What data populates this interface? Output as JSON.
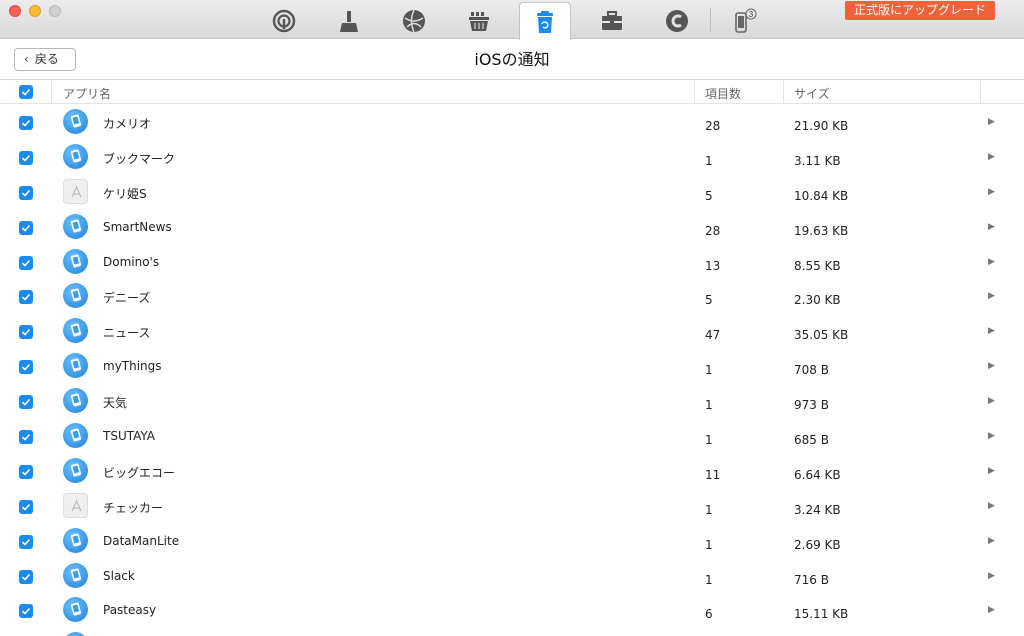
{
  "window": {
    "traffic_lights": [
      "close",
      "minimize",
      "zoom"
    ]
  },
  "toolbar": {
    "icons": [
      "airbackup-icon",
      "cleaner-icon",
      "internet-icon",
      "basket-icon",
      "trash-icon",
      "toolbox-icon",
      "copyright-icon",
      "device-icon"
    ],
    "active_icon": "trash-icon",
    "device_badge": "3",
    "upgrade_label": "正式版にアップグレード",
    "accent": "#f0623a"
  },
  "header": {
    "back_label": "戻る",
    "title": "iOSの通知"
  },
  "table": {
    "columns": {
      "name": "アプリ名",
      "count": "項目数",
      "size": "サイズ"
    },
    "check_color": "#1a8cf0",
    "rows": [
      {
        "name": "カメリオ",
        "count": "28",
        "size": "21.90 KB",
        "icon": "blue"
      },
      {
        "name": "ブックマーク",
        "count": "1",
        "size": "3.11 KB",
        "icon": "blue"
      },
      {
        "name": "ケリ姫S",
        "count": "5",
        "size": "10.84 KB",
        "icon": "store"
      },
      {
        "name": "SmartNews",
        "count": "28",
        "size": "19.63 KB",
        "icon": "blue"
      },
      {
        "name": "Domino's",
        "count": "13",
        "size": "8.55 KB",
        "icon": "blue"
      },
      {
        "name": "デニーズ",
        "count": "5",
        "size": "2.30 KB",
        "icon": "blue"
      },
      {
        "name": "ニュース",
        "count": "47",
        "size": "35.05 KB",
        "icon": "blue"
      },
      {
        "name": "myThings",
        "count": "1",
        "size": "708 B",
        "icon": "blue"
      },
      {
        "name": "天気",
        "count": "1",
        "size": "973 B",
        "icon": "blue"
      },
      {
        "name": "TSUTAYA",
        "count": "1",
        "size": "685 B",
        "icon": "blue"
      },
      {
        "name": "ビッグエコー",
        "count": "11",
        "size": "6.64 KB",
        "icon": "blue"
      },
      {
        "name": "チェッカー",
        "count": "1",
        "size": "3.24 KB",
        "icon": "store"
      },
      {
        "name": "DataManLite",
        "count": "1",
        "size": "2.69 KB",
        "icon": "blue"
      },
      {
        "name": "Slack",
        "count": "1",
        "size": "716 B",
        "icon": "blue"
      },
      {
        "name": "Pasteasy",
        "count": "6",
        "size": "15.11 KB",
        "icon": "blue"
      },
      {
        "name": "",
        "count": "",
        "size": "",
        "icon": "blue"
      }
    ]
  }
}
